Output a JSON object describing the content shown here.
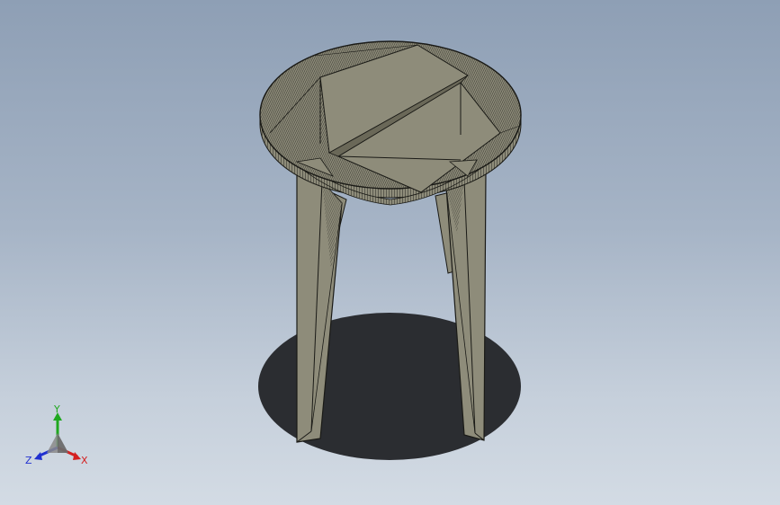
{
  "viewport": {
    "background_top": "#8e9fb5",
    "background_bottom": "#d3dbe4"
  },
  "model": {
    "body_color": "#8e8c7a",
    "edge_color": "#1a1a16",
    "shadow_color": "#2b2d31"
  },
  "triad": {
    "x_label": "X",
    "y_label": "Y",
    "z_label": "Z",
    "x_color": "#d42020",
    "y_color": "#1fa81f",
    "z_color": "#2030d0"
  }
}
